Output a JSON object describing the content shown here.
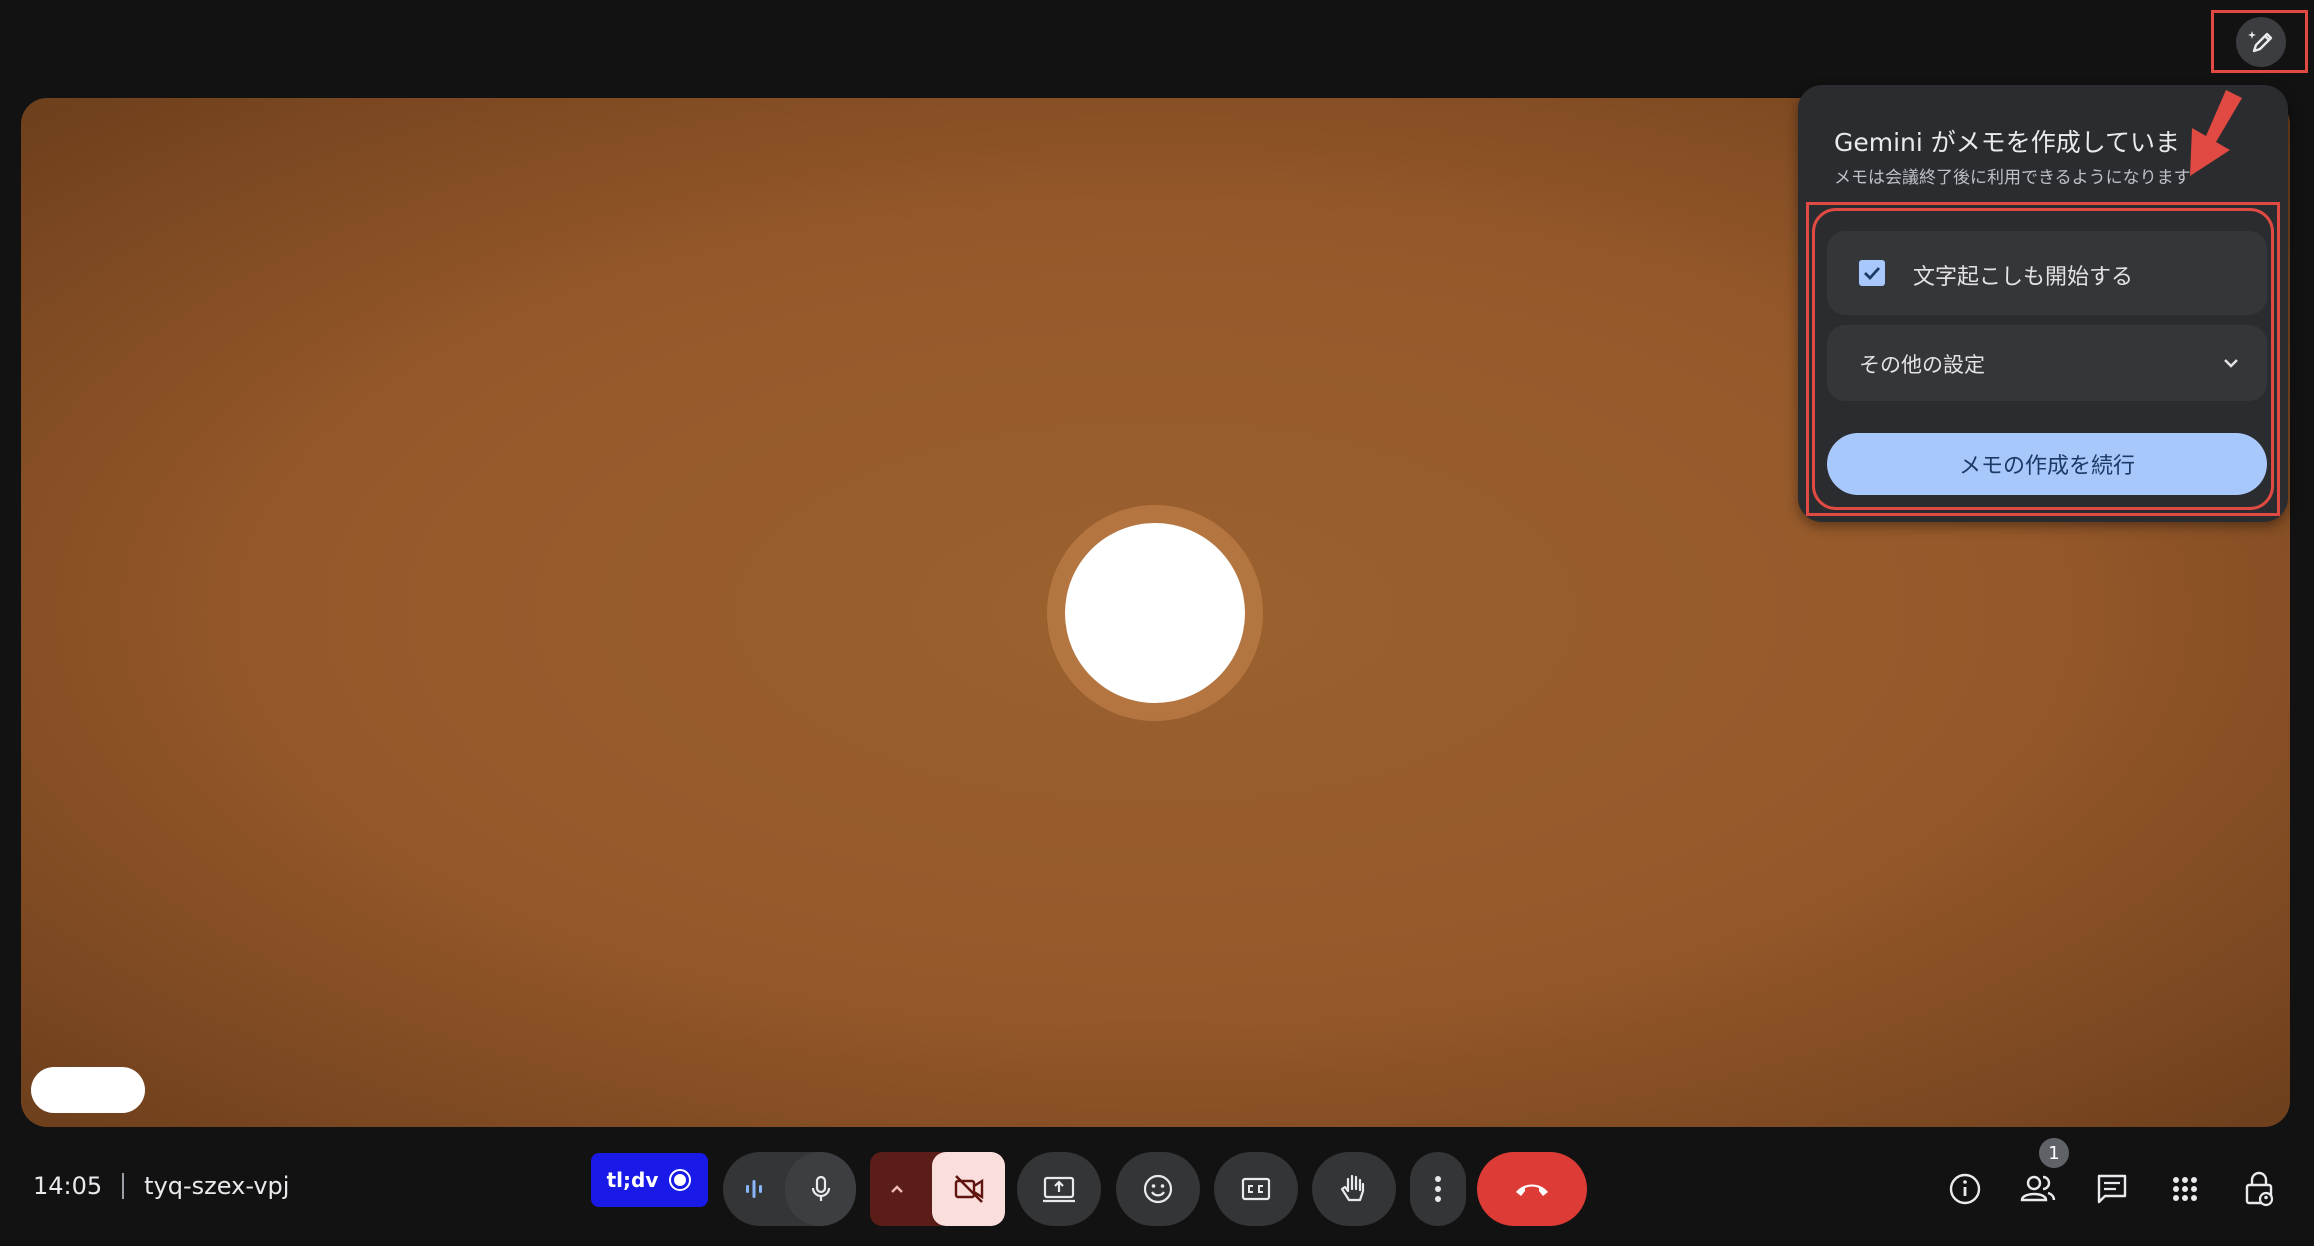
{
  "panel": {
    "title": "Gemini がメモを作成していま",
    "subtitle": "メモは会議終了後に利用できるようになります",
    "transcript_label": "文字起こしも開始する",
    "transcript_checked": true,
    "more_settings_label": "その他の設定",
    "continue_label": "メモの作成を続行"
  },
  "meeting": {
    "time": "14:05",
    "code": "tyq-szex-vpj"
  },
  "toolbar": {
    "tldv_label": "tl;dv"
  },
  "people": {
    "count_badge": "1"
  },
  "colors": {
    "accent_blue": "#a8c7fa",
    "end_call_red": "#dc3c35",
    "annotation_red": "#e04a42",
    "tldv_blue": "#1a1ae8"
  },
  "icons": [
    "notes-pencil-sparkle-icon",
    "checkmark-icon",
    "chevron-down-icon",
    "audio-wave-icon",
    "microphone-icon",
    "chevron-up-icon",
    "camera-off-icon",
    "present-screen-icon",
    "emoji-icon",
    "captions-icon",
    "raise-hand-icon",
    "more-vert-icon",
    "end-call-icon",
    "info-icon",
    "people-icon",
    "chat-icon",
    "apps-grid-icon",
    "host-controls-lock-icon"
  ]
}
